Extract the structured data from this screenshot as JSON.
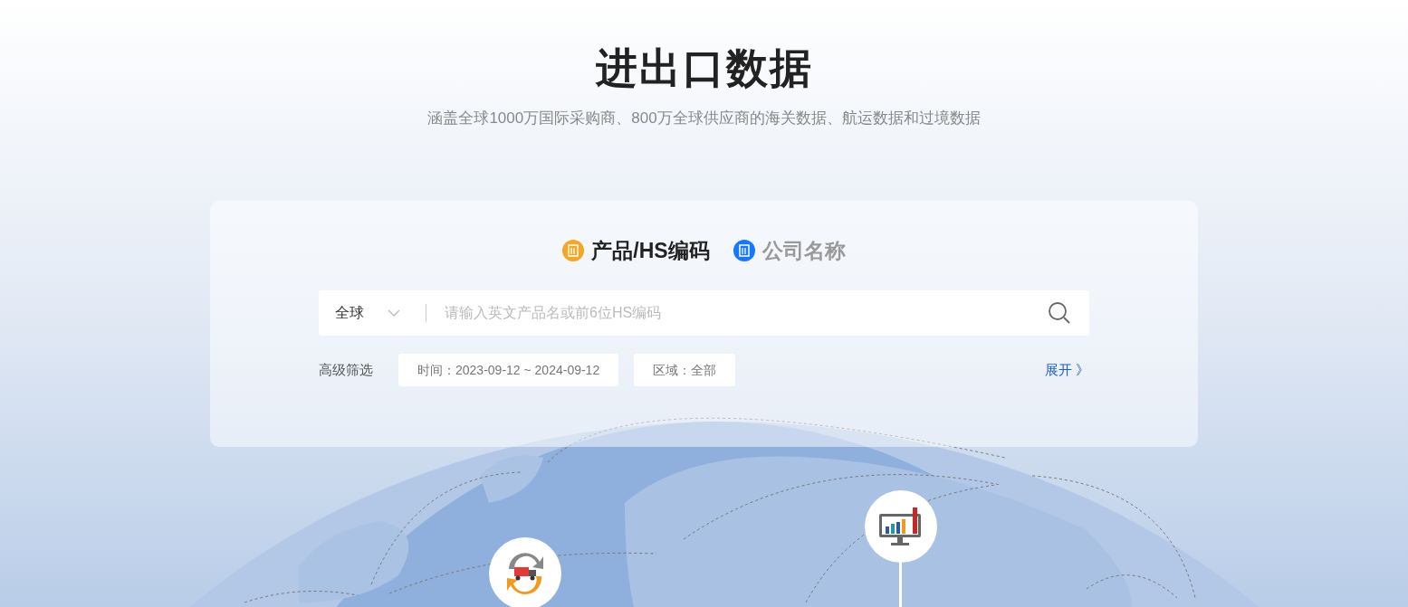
{
  "header": {
    "title": "进出口数据",
    "subtitle": "涵盖全球1000万国际采购商、800万全球供应商的海关数据、航运数据和过境数据"
  },
  "tabs": [
    {
      "label": "产品/HS编码",
      "selected": true,
      "color": "#f5a623"
    },
    {
      "label": "公司名称",
      "selected": false,
      "color": "#1677ff"
    }
  ],
  "search": {
    "region": "全球",
    "placeholder": "请输入英文产品名或前6位HS编码"
  },
  "filters": {
    "label": "高级筛选",
    "chips": [
      "时间：2023-09-12 ~ 2024-09-12",
      "区域：全部"
    ],
    "expand": "展开 》"
  }
}
